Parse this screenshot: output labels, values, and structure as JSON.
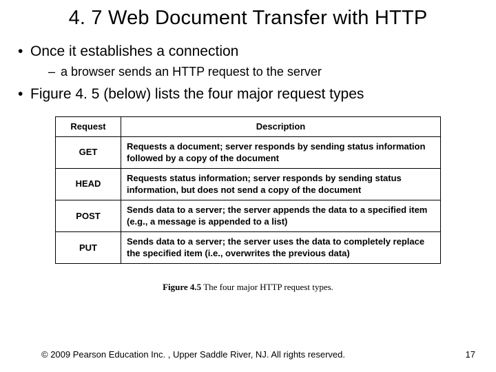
{
  "title": "4. 7  Web Document Transfer with HTTP",
  "bullets": [
    {
      "text": "Once it establishes a connection",
      "sub": [
        "a browser sends an HTTP request to the server"
      ]
    },
    {
      "text": "Figure 4. 5 (below) lists the four major request types",
      "sub": []
    }
  ],
  "table": {
    "headers": [
      "Request",
      "Description"
    ],
    "rows": [
      {
        "request": "GET",
        "description": "Requests a document; server responds by sending status information followed by a copy of the document"
      },
      {
        "request": "HEAD",
        "description": "Requests status information; server responds by sending status information, but does not send a copy of the document"
      },
      {
        "request": "POST",
        "description": "Sends data to a server; the server appends the data to a specified item (e.g., a message is appended to a list)"
      },
      {
        "request": "PUT",
        "description": "Sends data to a server; the server uses the data to completely replace the specified item (i.e., overwrites the previous data)"
      }
    ]
  },
  "caption": {
    "label": "Figure 4.5",
    "text": "The four major HTTP request types."
  },
  "footer": {
    "copyright": "© 2009 Pearson Education Inc. , Upper Saddle River, NJ. All rights reserved.",
    "page": "17"
  }
}
